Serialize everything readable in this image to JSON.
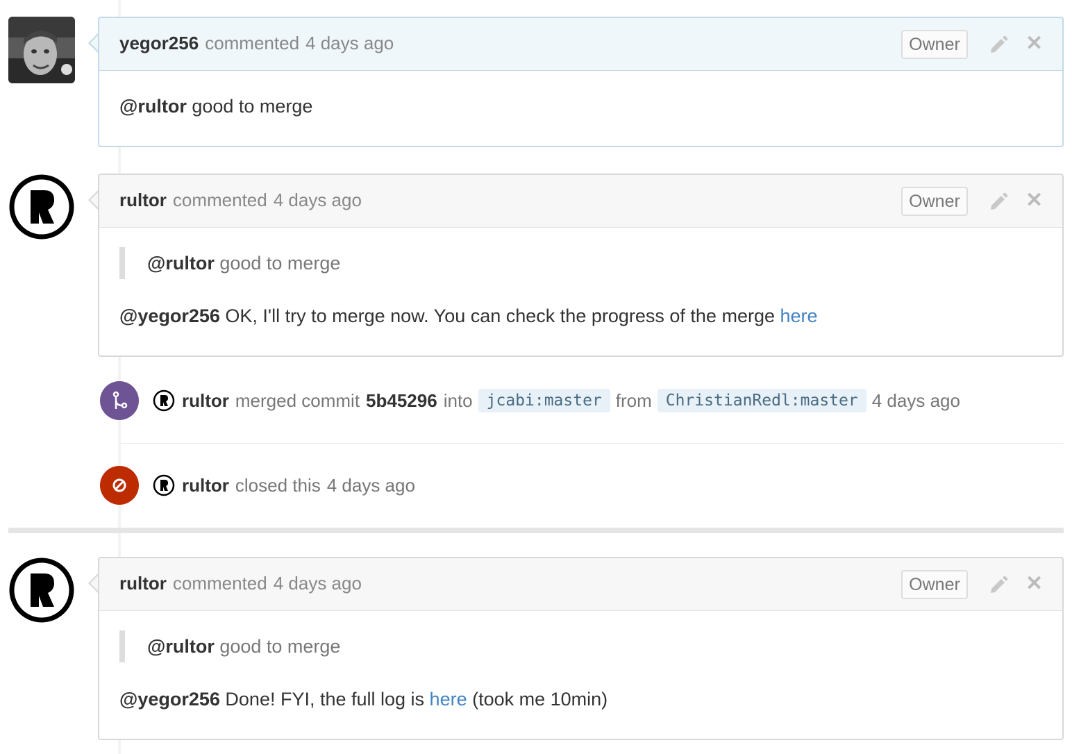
{
  "comments": [
    {
      "author": "yegor256",
      "action": "commented",
      "time": "4 days ago",
      "badge": "Owner",
      "body": {
        "mention": "@rultor",
        "text": " good to merge"
      }
    },
    {
      "author": "rultor",
      "action": "commented",
      "time": "4 days ago",
      "badge": "Owner",
      "quote": {
        "mention": "@rultor",
        "text": " good to merge"
      },
      "body": {
        "mention": "@yegor256",
        "text": " OK, I'll try to merge now. You can check the progress of the merge ",
        "link": "here"
      }
    },
    {
      "author": "rultor",
      "action": "commented",
      "time": "4 days ago",
      "badge": "Owner",
      "quote": {
        "mention": "@rultor",
        "text": " good to merge"
      },
      "body": {
        "mention": "@yegor256",
        "text": " Done! FYI, the full log is ",
        "link": "here",
        "after": " (took me 10min)"
      }
    }
  ],
  "events": {
    "merge": {
      "author": "rultor",
      "action": "merged commit",
      "sha": "5b45296",
      "into": "into",
      "target_branch": "jcabi:master",
      "from": "from",
      "source_branch": "ChristianRedl:master",
      "time": "4 days ago",
      "icon": "merge-icon",
      "color": "#6e5494"
    },
    "closed": {
      "author": "rultor",
      "action": "closed this",
      "time": "4 days ago",
      "icon": "closed-icon",
      "color": "#bd2c00"
    }
  }
}
